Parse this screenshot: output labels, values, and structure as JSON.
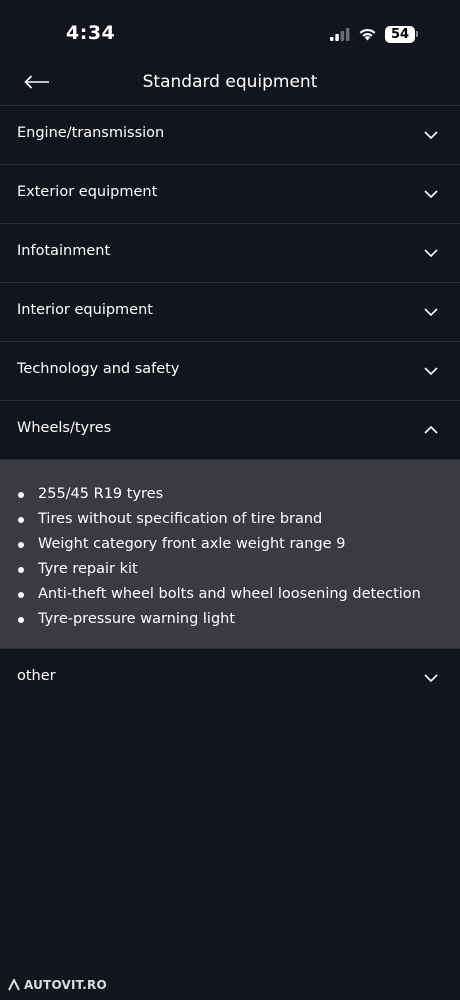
{
  "status_bar": {
    "time": "4:34",
    "battery": "54",
    "icons": [
      "signal-icon",
      "wifi-icon",
      "battery-icon"
    ]
  },
  "header": {
    "title": "Standard equipment",
    "back_icon": "arrow-left-icon"
  },
  "sections": [
    {
      "label": "Engine/transmission",
      "expanded": false
    },
    {
      "label": "Exterior equipment",
      "expanded": false
    },
    {
      "label": "Infotainment",
      "expanded": false
    },
    {
      "label": "Interior equipment",
      "expanded": false
    },
    {
      "label": "Technology and safety",
      "expanded": false
    },
    {
      "label": "Wheels/tyres",
      "expanded": true
    },
    {
      "label": "other",
      "expanded": false
    }
  ],
  "wheels_items": [
    "255/45 R19 tyres",
    "Tires without specification of tire brand",
    "Weight category front axle weight range 9",
    "Tyre repair kit",
    "Anti-theft wheel bolts and wheel loosening detection",
    "Tyre-pressure warning light"
  ],
  "watermark": {
    "text": "AUTOVIT.RO"
  },
  "colors": {
    "background": "#12151d",
    "expanded_panel": "#3a3b40",
    "divider": "#2a2e37",
    "text": "#ffffff"
  }
}
